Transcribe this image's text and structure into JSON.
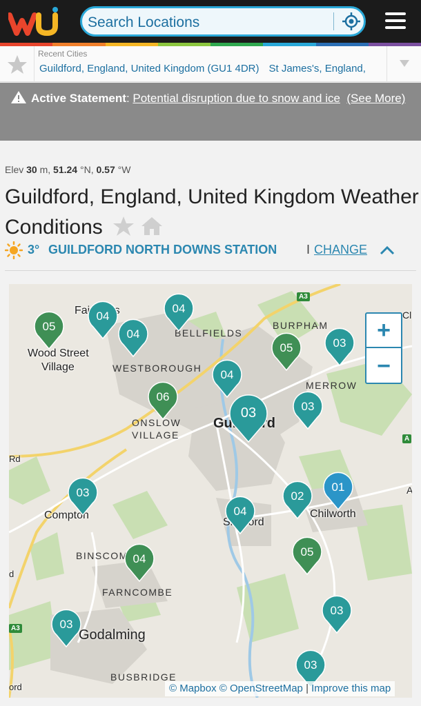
{
  "header": {
    "logo_text": "wu",
    "search_placeholder": "Search Locations"
  },
  "recent": {
    "title": "Recent Cities",
    "cities": [
      "Guildford, England, United Kingdom (GU1 4DR)",
      "St James's, England,"
    ]
  },
  "statement": {
    "label": "Active Statement",
    "separator": ": ",
    "link": "Potential disruption due to snow and ice",
    "more": "(See More)"
  },
  "location": {
    "elev_label": "Elev",
    "elev_value": "30",
    "elev_unit": "m,",
    "lat": "51.24",
    "lat_unit": "°N,",
    "lon": "0.57",
    "lon_unit": "°W",
    "title": "Guildford, England, United Kingdom Weather Conditions",
    "temp": "3°",
    "station": "GUILDFORD NORTH DOWNS STATION",
    "pipe": "I",
    "change": "CHANGE"
  },
  "map": {
    "places": [
      {
        "name": "Fairlands",
        "id": "fairlands"
      },
      {
        "name": "Wood Street",
        "id": "wood-street"
      },
      {
        "name": "Village",
        "id": "village"
      },
      {
        "name": "BELLFIELDS",
        "id": "bellfields"
      },
      {
        "name": "BURPHAM",
        "id": "burpham"
      },
      {
        "name": "WESTBOROUGH",
        "id": "westborough"
      },
      {
        "name": "MERROW",
        "id": "merrow"
      },
      {
        "name": "ONSLOW",
        "id": "onslow"
      },
      {
        "name": "VILLAGE",
        "id": "village-2"
      },
      {
        "name": "Guildford",
        "id": "guildford"
      },
      {
        "name": "Compton",
        "id": "compton"
      },
      {
        "name": "Shalford",
        "id": "shalford"
      },
      {
        "name": "Chilworth",
        "id": "chilworth"
      },
      {
        "name": "BINSCOMBE",
        "id": "binscombe"
      },
      {
        "name": "FARNCOMBE",
        "id": "farncombe"
      },
      {
        "name": "Godalming",
        "id": "godalming"
      },
      {
        "name": "BUSBRIDGE",
        "id": "busbridge"
      },
      {
        "name": "Rd",
        "id": "rd"
      },
      {
        "name": "ord",
        "id": "ord"
      },
      {
        "name": "d",
        "id": "d"
      },
      {
        "name": "Cl",
        "id": "cl"
      },
      {
        "name": "A",
        "id": "a-edge"
      }
    ],
    "roads": [
      "A3",
      "A",
      "A3"
    ],
    "pins": [
      {
        "value": "05",
        "color": "#3f8f55"
      },
      {
        "value": "04",
        "color": "#2a9a9a"
      },
      {
        "value": "04",
        "color": "#2a9a9a"
      },
      {
        "value": "04",
        "color": "#2a9a9a"
      },
      {
        "value": "05",
        "color": "#3f8f55"
      },
      {
        "value": "03",
        "color": "#2a9a9a"
      },
      {
        "value": "04",
        "color": "#2a9a9a"
      },
      {
        "value": "06",
        "color": "#3f8f55"
      },
      {
        "value": "03",
        "color": "#2a9a9a"
      },
      {
        "value": "03",
        "color": "#2a9a9a"
      },
      {
        "value": "03",
        "color": "#2a9a9a"
      },
      {
        "value": "02",
        "color": "#2a9a9a"
      },
      {
        "value": "01",
        "color": "#2b95c8"
      },
      {
        "value": "04",
        "color": "#2a9a9a"
      },
      {
        "value": "05",
        "color": "#3f8f55"
      },
      {
        "value": "04",
        "color": "#3f8f55"
      },
      {
        "value": "03",
        "color": "#2a9a9a"
      },
      {
        "value": "03",
        "color": "#2a9a9a"
      },
      {
        "value": "03",
        "color": "#2a9a9a"
      }
    ],
    "zoom_in": "+",
    "zoom_out": "−",
    "attribution": {
      "mapbox": "© Mapbox",
      "osm": "© OpenStreetMap",
      "divider": "|",
      "improve": "Improve this map"
    }
  },
  "colors": {
    "accent": "#2b87b0",
    "statement_bg": "#8a8a8a",
    "header_bg": "#1b1b1b"
  },
  "icons": [
    "logo-icon",
    "locate-icon",
    "menu-icon",
    "star-icon",
    "caret-down-icon",
    "warning-icon",
    "home-icon",
    "sun-icon",
    "chevron-up-icon"
  ]
}
